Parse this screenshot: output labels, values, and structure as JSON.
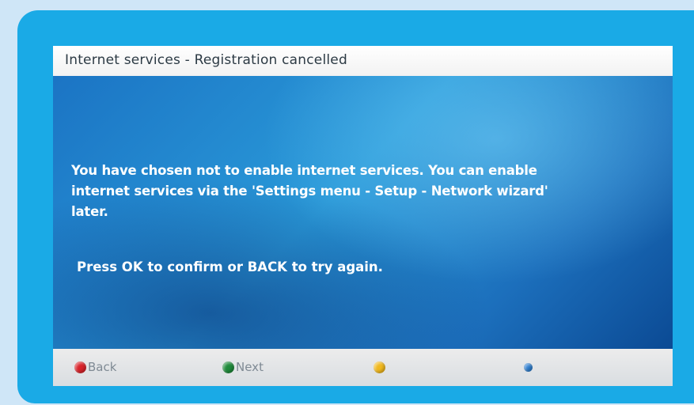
{
  "dialog": {
    "title": "Internet services - Registration cancelled",
    "message_lines": [
      "You have chosen not to enable internet services. You can enable",
      "internet services via the 'Settings menu - Setup - Network wizard'",
      "later."
    ],
    "confirm_text": "Press OK to confirm or BACK to try again."
  },
  "button_bar": {
    "keys": [
      {
        "label": "Back",
        "color": "#d8232a",
        "icon": "red-button-icon"
      },
      {
        "label": "Next",
        "color": "#1f8a3a",
        "icon": "green-button-icon"
      },
      {
        "label": "",
        "color": "#f0b81e",
        "icon": "yellow-button-icon"
      },
      {
        "label": "",
        "color": "#2f7fd0",
        "icon": "blue-button-icon"
      }
    ]
  },
  "colors": {
    "frame": "#1aaae6",
    "background": "#cfe6f7",
    "title_bar": "#ffffff"
  }
}
